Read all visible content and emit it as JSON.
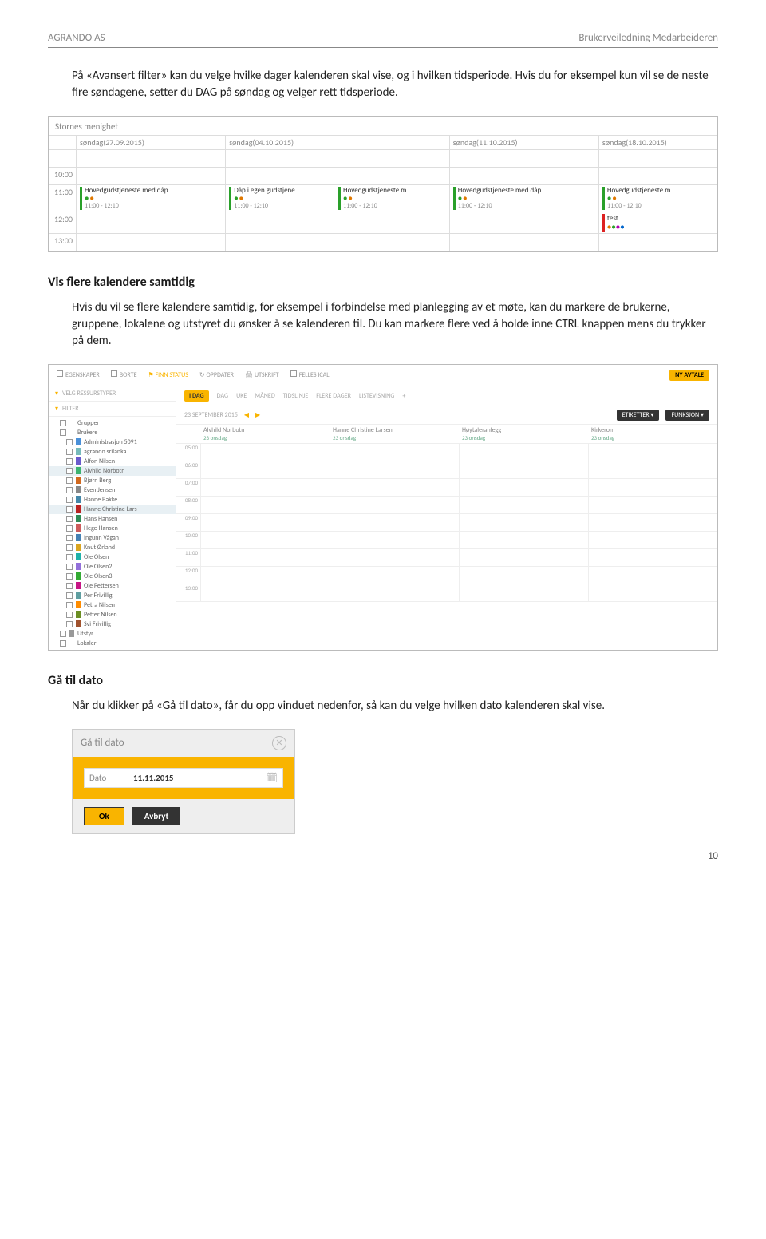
{
  "header": {
    "left": "AGRANDO AS",
    "right": "Brukerveiledning Medarbeideren"
  },
  "para1": "På «Avansert filter» kan du velge hvilke dager kalenderen skal vise, og i hvilken tidsperiode. Hvis du for eksempel kun vil se de neste fire søndagene, setter du DAG på søndag og velger rett tidsperiode.",
  "sec2_title": "Vis flere kalendere samtidig",
  "para2": "Hvis du vil se flere kalendere samtidig, for eksempel i forbindelse med planlegging av et møte, kan du markere de brukerne, gruppene, lokalene og utstyret du ønsker å se kalenderen til. Du kan markere flere ved å holde inne CTRL knappen mens du trykker på dem.",
  "sec3_title": "Gå til dato",
  "para3": "Når du klikker på «Gå til dato», får du opp vinduet nedenfor, så kan du velge hvilken dato kalenderen skal vise.",
  "page_number": "10",
  "shot1": {
    "title": "Stornes menighet",
    "days": [
      "søndag(27.09.2015)",
      "søndag(04.10.2015)",
      "søndag(11.10.2015)",
      "søndag(18.10.2015)"
    ],
    "times": [
      "10:00",
      "11:00",
      "12:00",
      "13:00"
    ],
    "events": {
      "c0": {
        "name": "Hovedgudstjeneste med dåp",
        "time": "11:00 - 12:10"
      },
      "c1a": {
        "name": "Dåp i egen gudstjene",
        "time": "11:00 - 12:10"
      },
      "c1b": {
        "name": "Hovedgudstjeneste m",
        "time": "11:00 - 12:10"
      },
      "c2": {
        "name": "Hovedgudstjeneste med dåp",
        "time": "11:00 - 12:10"
      },
      "c3": {
        "name": "Hovedgudstjeneste m",
        "time": "11:00 - 12:10"
      },
      "test": "test"
    }
  },
  "shot2": {
    "toolbar": [
      "EGENSKAPER",
      "BORTE",
      "FINN STATUS",
      "OPPDATER",
      "UTSKRIFT",
      "FELLES ICAL"
    ],
    "nyavtale": "NY AVTALE",
    "velg": "VELG RESSURSTYPER",
    "viewtabs": [
      "I DAG",
      "DAG",
      "UKE",
      "MÅNED",
      "TIDSLINJE",
      "FLERE DAGER",
      "LISTEVISNING"
    ],
    "filter": "FILTER",
    "etiketter": "ETIKETTER",
    "funksjon": "FUNKSJON",
    "date": "23 SEPTEMBER 2015",
    "groups": {
      "Grupper": [],
      "Brukere": [
        "Administrasjon 5091",
        "agrando srilanka",
        "Alfon Nilsen",
        "Alvhild Norbotn",
        "Bjørn Berg",
        "Even Jensen",
        "Hanne Bakke",
        "Hanne Christine Lars",
        "Hans Hansen",
        "Hege Hansen",
        "Ingunn Vågan",
        "Knut Ørland",
        "Ole Olsen",
        "Ole Olsen2",
        "Ole Olsen3",
        "Ole Pettersen",
        "Per Frivillig",
        "Petra Nilsen",
        "Petter Nilsen",
        "Svi Frivillig"
      ],
      "Utstyr": [],
      "Lokaler": []
    },
    "selected": [
      "Alvhild Norbotn",
      "Hanne Christine Lars"
    ],
    "columns": [
      {
        "name": "Alvhild Norbotn",
        "sub": "23 onsdag"
      },
      {
        "name": "Hanne Christine Larsen",
        "sub": "23 onsdag"
      },
      {
        "name": "Høytaleranlegg",
        "sub": "23 onsdag"
      },
      {
        "name": "Kirkerom",
        "sub": "23 onsdag"
      }
    ],
    "times": [
      "05:00",
      "06:00",
      "07:00",
      "08:00",
      "09:00",
      "10:00",
      "11:00",
      "12:00",
      "13:00"
    ]
  },
  "shot3": {
    "title": "Gå til dato",
    "label": "Dato",
    "value": "11.11.2015",
    "ok": "Ok",
    "cancel": "Avbryt"
  }
}
